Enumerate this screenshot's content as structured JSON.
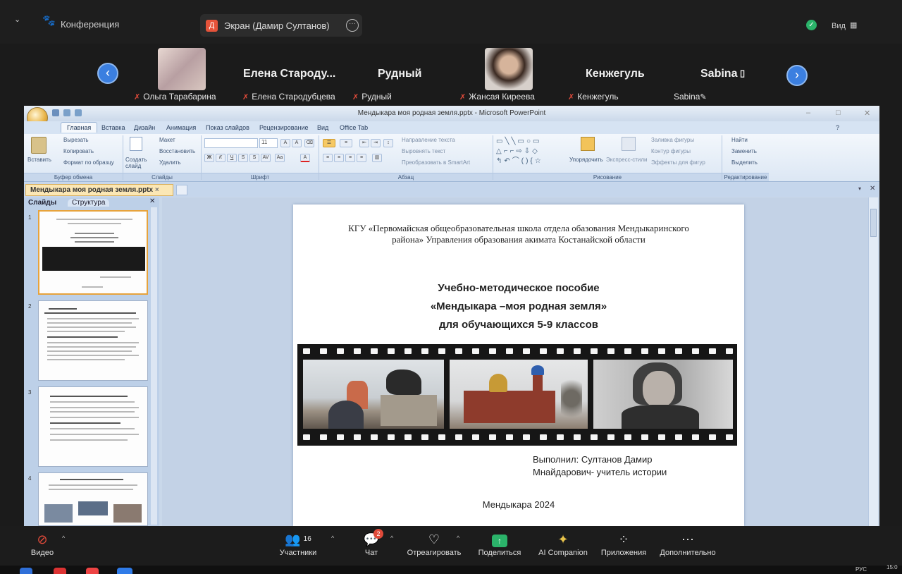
{
  "topbar": {
    "conference_label": "Конференция",
    "screen_initial": "Д",
    "screen_label": "Экран (Дамир Султанов)",
    "view_label": "Вид"
  },
  "participants": {
    "tile_names": [
      "Елена  Староду...",
      "Рудный",
      "Кенжегуль",
      "Sabina"
    ],
    "labels": [
      "Ольга Тарабарина",
      "Елена Стародубцева",
      "Рудный",
      "Жансая Киреева",
      "Кенжегуль",
      "Sabina"
    ]
  },
  "ppt": {
    "window_title": "Мендыкара моя родная земля.pptx - Microsoft PowerPoint",
    "tabs": [
      "Главная",
      "Вставка",
      "Дизайн",
      "Анимация",
      "Показ слайдов",
      "Рецензирование",
      "Вид",
      "Office Tab"
    ],
    "clipboard": {
      "paste": "Вставить",
      "cut": "Вырезать",
      "copy": "Копировать",
      "format": "Формат по образцу"
    },
    "slides_group": {
      "create": "Создать слайд",
      "layout": "Макет",
      "reset": "Восстановить",
      "delete": "Удалить"
    },
    "paragraph": {
      "dir": "Направление текста",
      "align": "Выровнять текст",
      "smartart": "Преобразовать в SmartArt"
    },
    "drawing": {
      "arrange": "Упорядочить",
      "styles": "Экспресс-стили",
      "fill": "Заливка фигуры",
      "outline": "Контур фигуры",
      "effects": "Эффекты для фигур"
    },
    "editing": {
      "find": "Найти",
      "replace": "Заменить",
      "select": "Выделить"
    },
    "group_labels": [
      "Буфер обмена",
      "Слайды",
      "Шрифт",
      "Абзац",
      "Рисование",
      "Редактирование"
    ],
    "font_size": "11",
    "doc_tab": "Мендыкара моя родная земля.pptx",
    "panel_tabs": [
      "Слайды",
      "Структура"
    ],
    "thumb_numbers": [
      "1",
      "2",
      "3",
      "4"
    ]
  },
  "slide": {
    "org_line1": "КГУ «Первомайская общеобразовательная школа отдела обазования Мендыкаринского",
    "org_line2": "района» Управления образования акимата Костанайской области",
    "title1": "Учебно-методическое пособие",
    "title2": "«Мендыкара –моя родная земля»",
    "title3": "для обучающихся  5-9 классов",
    "author1": "Выполнил: Султанов Дамир",
    "author2": "Мнайдарович- учитель истории",
    "place_year": "Мендыкара 2024"
  },
  "bottombar": {
    "video": "Видео",
    "participants_count": "16",
    "participants": "Участники",
    "chat_badge": "2",
    "chat": "Чат",
    "react": "Отреагировать",
    "share": "Поделиться",
    "ai": "AI Companion",
    "apps": "Приложения",
    "more": "Дополнительно"
  },
  "taskbar": {
    "lang": "РУС",
    "time": "15:0"
  },
  "colors": {
    "accent": "#3b7fe0",
    "share_green": "#2bb36a",
    "office_orange": "#e7a33c"
  }
}
